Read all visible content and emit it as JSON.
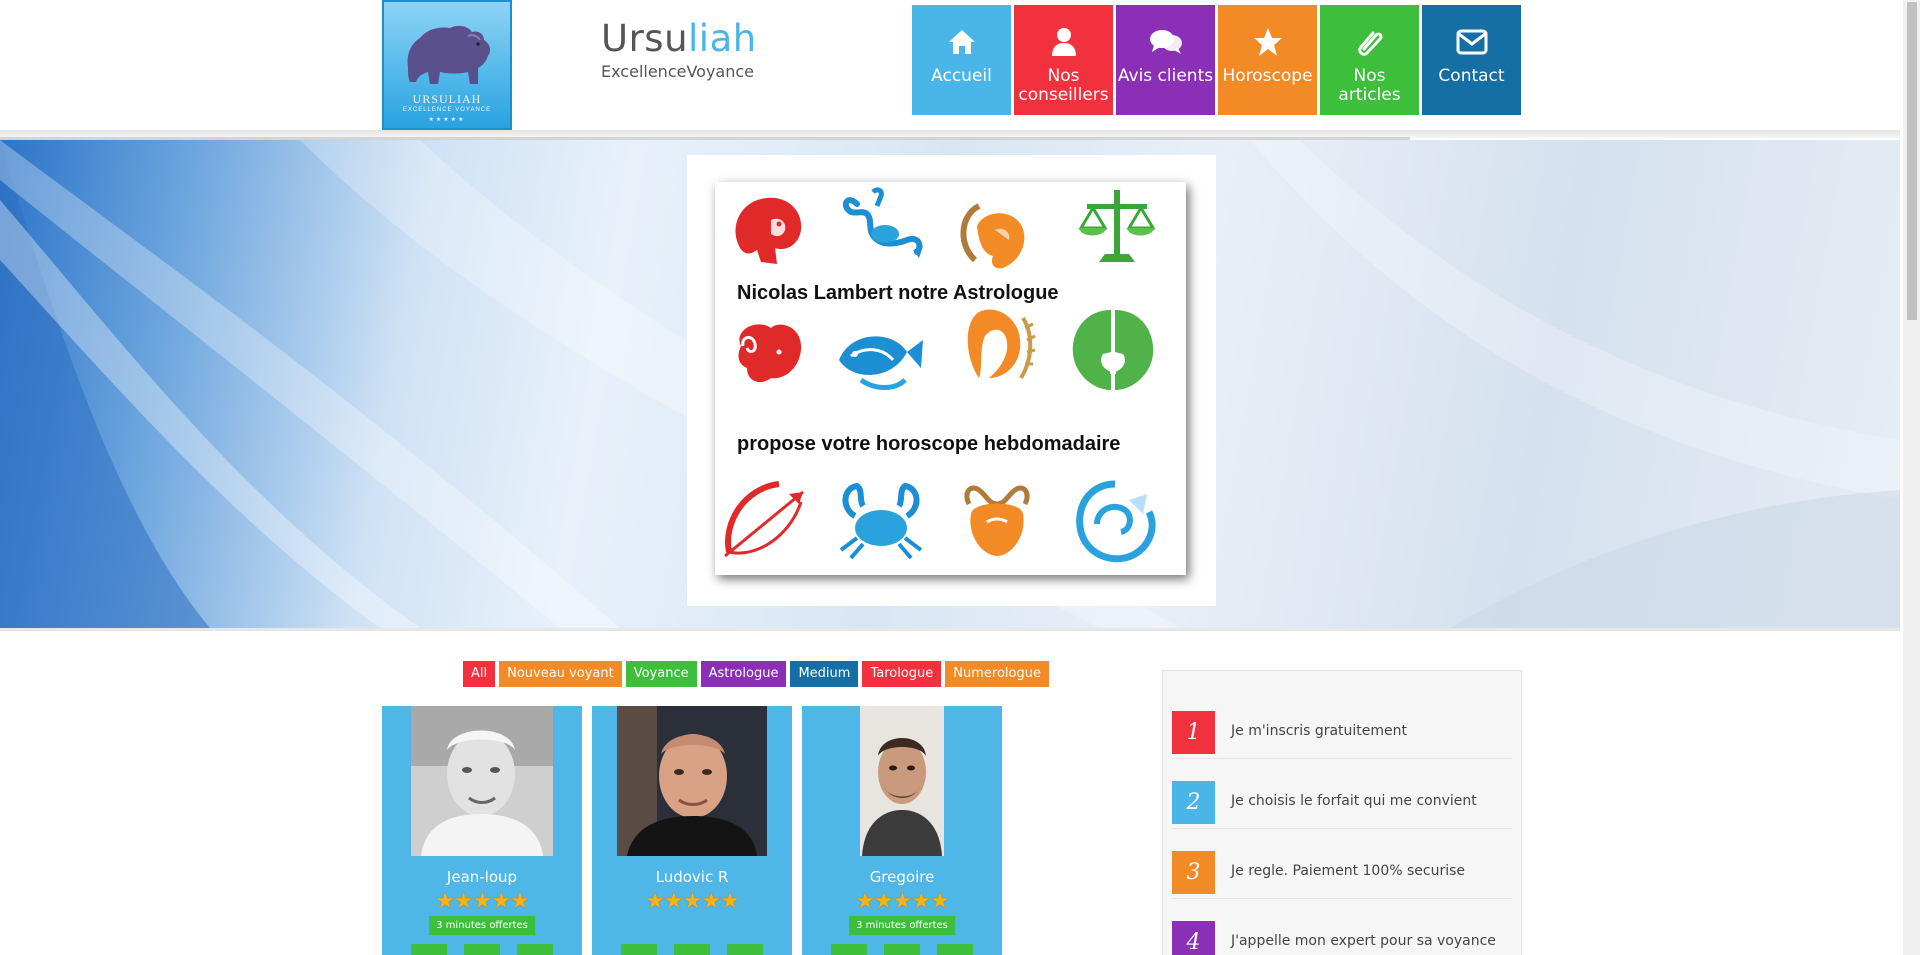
{
  "brand": {
    "logo_text": "URSULIAH",
    "logo_subtext": "EXCELLENCE VOYANCE",
    "logo_stars": "★★★★★",
    "title_main": "Ursu",
    "title_accent": "liah",
    "subtitle": "ExcellenceVoyance"
  },
  "nav": {
    "items": [
      {
        "label": "Accueil",
        "icon": "home-icon",
        "color": "#4ab5e8"
      },
      {
        "label": "Nos conseillers",
        "icon": "user-icon",
        "color": "#f2313e"
      },
      {
        "label": "Avis clients",
        "icon": "comments-icon",
        "color": "#8b2fb6"
      },
      {
        "label": "Horoscope",
        "icon": "star-icon",
        "color": "#f28b25"
      },
      {
        "label": "Nos articles",
        "icon": "paperclip-icon",
        "color": "#3dbf3b"
      },
      {
        "label": "Contact",
        "icon": "envelope-icon",
        "color": "#166fa4"
      }
    ]
  },
  "hero": {
    "line1": "Nicolas Lambert  notre Astrologue",
    "line2": "propose votre horoscope hebdomadaire"
  },
  "filters": [
    {
      "label": "All",
      "color": "#f2313e"
    },
    {
      "label": "Nouveau voyant",
      "color": "#f28b25"
    },
    {
      "label": "Voyance",
      "color": "#3dbf3b"
    },
    {
      "label": "Astrologue",
      "color": "#8b2fb6"
    },
    {
      "label": "Medium",
      "color": "#166fa4"
    },
    {
      "label": "Tarologue",
      "color": "#f2313e"
    },
    {
      "label": "Numerologue",
      "color": "#f28b25"
    }
  ],
  "experts": [
    {
      "name": "Jean-loup",
      "rating": 5,
      "stars": "★★★★★",
      "badge": "3 minutes offertes"
    },
    {
      "name": "Ludovic R",
      "rating": 5,
      "stars": "★★★★★",
      "badge": ""
    },
    {
      "name": "Gregoire",
      "rating": 5,
      "stars": "★★★★★",
      "badge": "3 minutes offertes"
    }
  ],
  "steps": [
    {
      "number": "1",
      "text": "Je m'inscris gratuitement",
      "color": "#f2313e"
    },
    {
      "number": "2",
      "text": "Je choisis le forfait qui me convient",
      "color": "#4ab5e8"
    },
    {
      "number": "3",
      "text": "Je regle. Paiement 100% securise",
      "color": "#f28b25"
    },
    {
      "number": "4",
      "text": "J'appelle mon expert pour sa voyance",
      "color": "#8b2fb6"
    }
  ]
}
